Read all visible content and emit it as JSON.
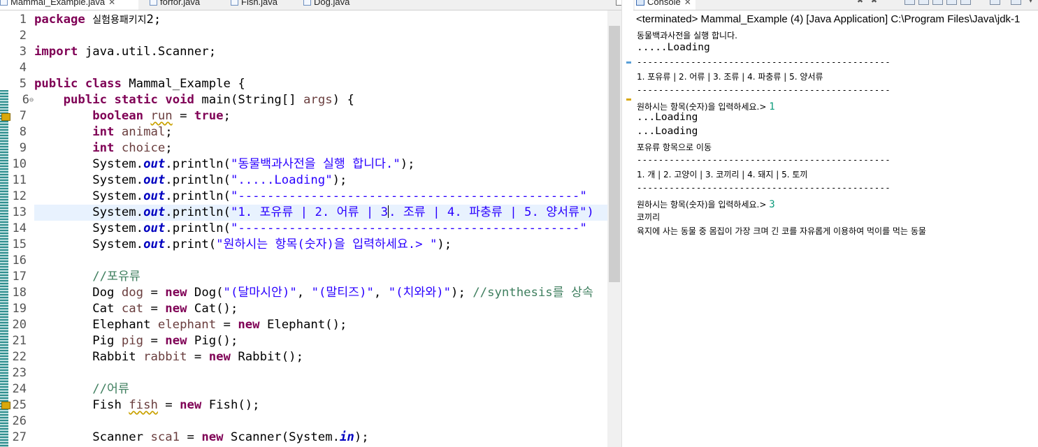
{
  "editor": {
    "tabs": [
      {
        "label": "Mammal_Example.java",
        "active": true,
        "closable": true
      },
      {
        "label": "forfor.java",
        "active": false
      },
      {
        "label": "Fish.java",
        "active": false
      },
      {
        "label": "Dog.java",
        "active": false
      }
    ],
    "line_numbers": [
      "1",
      "2",
      "3",
      "4",
      "5",
      "6",
      "7",
      "8",
      "9",
      "10",
      "11",
      "12",
      "13",
      "14",
      "15",
      "16",
      "17",
      "18",
      "19",
      "20",
      "21",
      "22",
      "23",
      "24",
      "25",
      "26",
      "27"
    ],
    "fold_marker": "⊖",
    "code": {
      "l1": [
        "package",
        " ",
        "실험용패키지",
        "2;"
      ],
      "l3": [
        "import",
        " java.util.Scanner;"
      ],
      "l5": [
        "public",
        " ",
        "class",
        " Mammal_Example {"
      ],
      "l6": [
        "public",
        " ",
        "static",
        " ",
        "void",
        " main(String[] ",
        "args",
        ") {"
      ],
      "l7": [
        "boolean",
        " ",
        "run",
        " = ",
        "true",
        ";"
      ],
      "l8": [
        "int",
        " ",
        "animal",
        ";"
      ],
      "l9": [
        "int",
        " ",
        "choice",
        ";"
      ],
      "l10": [
        "System.",
        "out",
        ".println(",
        "\"동물백과사전을 실행 합니다.\"",
        ");"
      ],
      "l11": [
        "System.",
        "out",
        ".println(",
        "\".....Loading\"",
        ");"
      ],
      "l12": [
        "System.",
        "out",
        ".println(",
        "\"-----------------------------------------------\""
      ],
      "l13": [
        "System.",
        "out",
        ".println(",
        "\"1. 포유류 | 2. 어류 | 3",
        ". 조류 | 4. 파충류 | 5. 양서류\")"
      ],
      "l14": [
        "System.",
        "out",
        ".println(",
        "\"-----------------------------------------------\""
      ],
      "l15": [
        "System.",
        "out",
        ".print(",
        "\"원하시는 항목(숫자)을 입력하세요.> \"",
        ");"
      ],
      "l17": [
        "//포유류"
      ],
      "l18": [
        "Dog ",
        "dog",
        " = ",
        "new",
        " Dog(",
        "\"(달마시안)\"",
        ", ",
        "\"(말티즈)\"",
        ", ",
        "\"(치와와)\"",
        "); ",
        "//synthesis를 상속"
      ],
      "l19": [
        "Cat ",
        "cat",
        " = ",
        "new",
        " Cat();"
      ],
      "l20": [
        "Elephant ",
        "elephant",
        " = ",
        "new",
        " Elephant();"
      ],
      "l21": [
        "Pig ",
        "pig",
        " = ",
        "new",
        " Pig();"
      ],
      "l22": [
        "Rabbit ",
        "rabbit",
        " = ",
        "new",
        " Rabbit();"
      ],
      "l24": [
        "//어류"
      ],
      "l25": [
        "Fish ",
        "fish",
        " = ",
        "new",
        " Fish();"
      ],
      "l27": [
        "Scanner ",
        "sca1",
        " = ",
        "new",
        " Scanner(System.",
        "in",
        ");"
      ]
    }
  },
  "console": {
    "tab_label": "Console",
    "status": "<terminated> Mammal_Example (4) [Java Application] C:\\Program Files\\Java\\jdk-1",
    "lines": [
      "동물백과사전을 실행 합니다.",
      ".....Loading",
      "-----------------------------------------------",
      "1. 포유류 | 2. 어류 | 3. 조류 | 4. 파충류 | 5. 양서류",
      "-----------------------------------------------",
      "원하시는 항목(숫자)을 입력하세요.> ",
      "1",
      "...Loading",
      "...Loading",
      "포유류 항목으로 이동",
      "-----------------------------------------------",
      "1. 개 | 2. 고양이 | 3. 코끼리 | 4. 돼지 | 5. 토끼",
      "-----------------------------------------------",
      "원하시는 항목(숫자)을 입력하세요.> ",
      "3",
      "코끼리",
      "육지에 사는 동물 중 몸집이 가장 크며 긴 코를 자유롭게 이용하여 먹이를 먹는 동물"
    ]
  },
  "colors": {
    "keyword": "#7f0055",
    "string": "#2a00ff",
    "comment": "#3f7f5f",
    "static_field": "#0000c0",
    "local_variable": "#6a3e3e",
    "console_input": "#0a9a7a",
    "current_line": "#e8f2fe"
  },
  "icons": [
    "java-file-icon",
    "close-icon",
    "console-monitor-icon",
    "warning-icon",
    "fold-collapse-icon"
  ]
}
